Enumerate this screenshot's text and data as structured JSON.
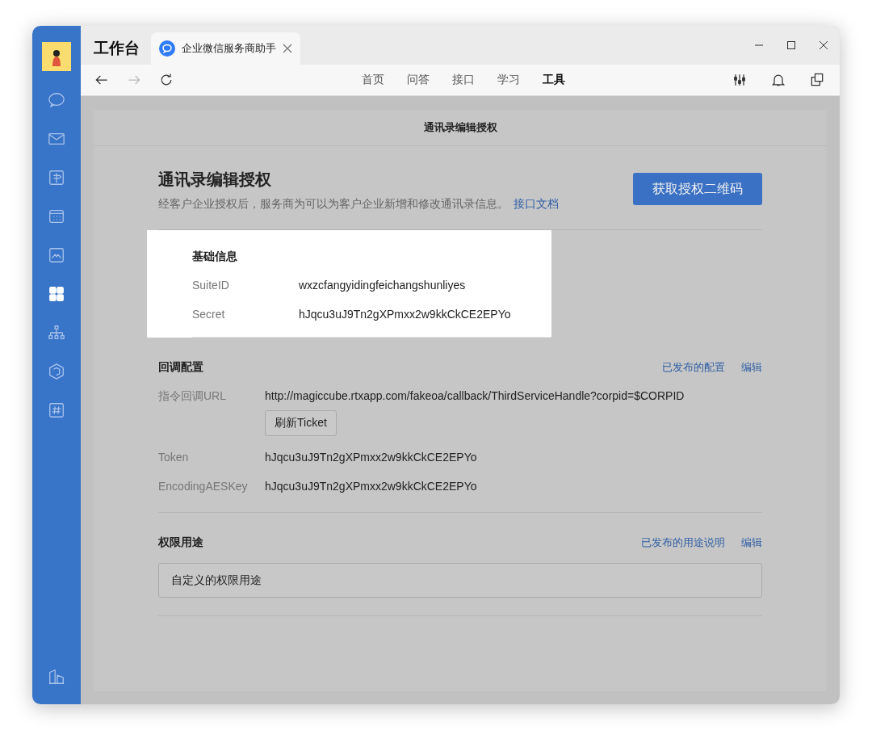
{
  "window": {
    "title": "工作台"
  },
  "browser_tab": {
    "title": "企业微信服务商助手",
    "selected": true
  },
  "sidebar": {
    "items": [
      {
        "kind": "chat",
        "selected": false
      },
      {
        "kind": "mail",
        "selected": false
      },
      {
        "kind": "sign",
        "selected": false
      },
      {
        "kind": "calendar",
        "selected": false
      },
      {
        "kind": "photo",
        "selected": false
      },
      {
        "kind": "grid",
        "selected": true
      },
      {
        "kind": "org",
        "selected": false
      },
      {
        "kind": "cube",
        "selected": false
      },
      {
        "kind": "hash",
        "selected": false
      }
    ],
    "bottom_items": [
      {
        "kind": "buildings",
        "selected": false
      }
    ]
  },
  "nav": {
    "back_disabled": false,
    "forward_disabled": true,
    "links": [
      {
        "label": "首页",
        "selected": false
      },
      {
        "label": "问答",
        "selected": false
      },
      {
        "label": "接口",
        "selected": false
      },
      {
        "label": "学习",
        "selected": false
      },
      {
        "label": "工具",
        "selected": true
      }
    ]
  },
  "panel": {
    "title": "通讯录编辑授权",
    "heading": "通讯录编辑授权",
    "description": "经客户企业授权后，服务商为可以为客户企业新增和修改通讯录信息。",
    "doc_link": "接口文档",
    "primary_button": "获取授权二维码",
    "basic_info": {
      "title": "基础信息",
      "highlighted": true,
      "rows": [
        {
          "label": "SuiteID",
          "value": "wxzcfangyidingfeichangshunliyes"
        },
        {
          "label": "Secret",
          "value": "hJqcu3uJ9Tn2gXPmxx2w9kkCkCE2EPYo"
        }
      ]
    },
    "callback": {
      "title": "回调配置",
      "links": [
        "已发布的配置",
        "编辑"
      ],
      "rows": [
        {
          "label": "指令回调URL",
          "value": "http://magiccube.rtxapp.com/fakeoa/callback/ThirdServiceHandle?corpid=$CORPID",
          "button": "刷新Ticket"
        },
        {
          "label": "Token",
          "value": "hJqcu3uJ9Tn2gXPmxx2w9kkCkCE2EPYo"
        },
        {
          "label": "EncodingAESKey",
          "value": "hJqcu3uJ9Tn2gXPmxx2w9kkCkCE2EPYo"
        }
      ]
    },
    "usage": {
      "title": "权限用途",
      "links": [
        "已发布的用途说明",
        "编辑"
      ],
      "field_value": "自定义的权限用途"
    }
  }
}
